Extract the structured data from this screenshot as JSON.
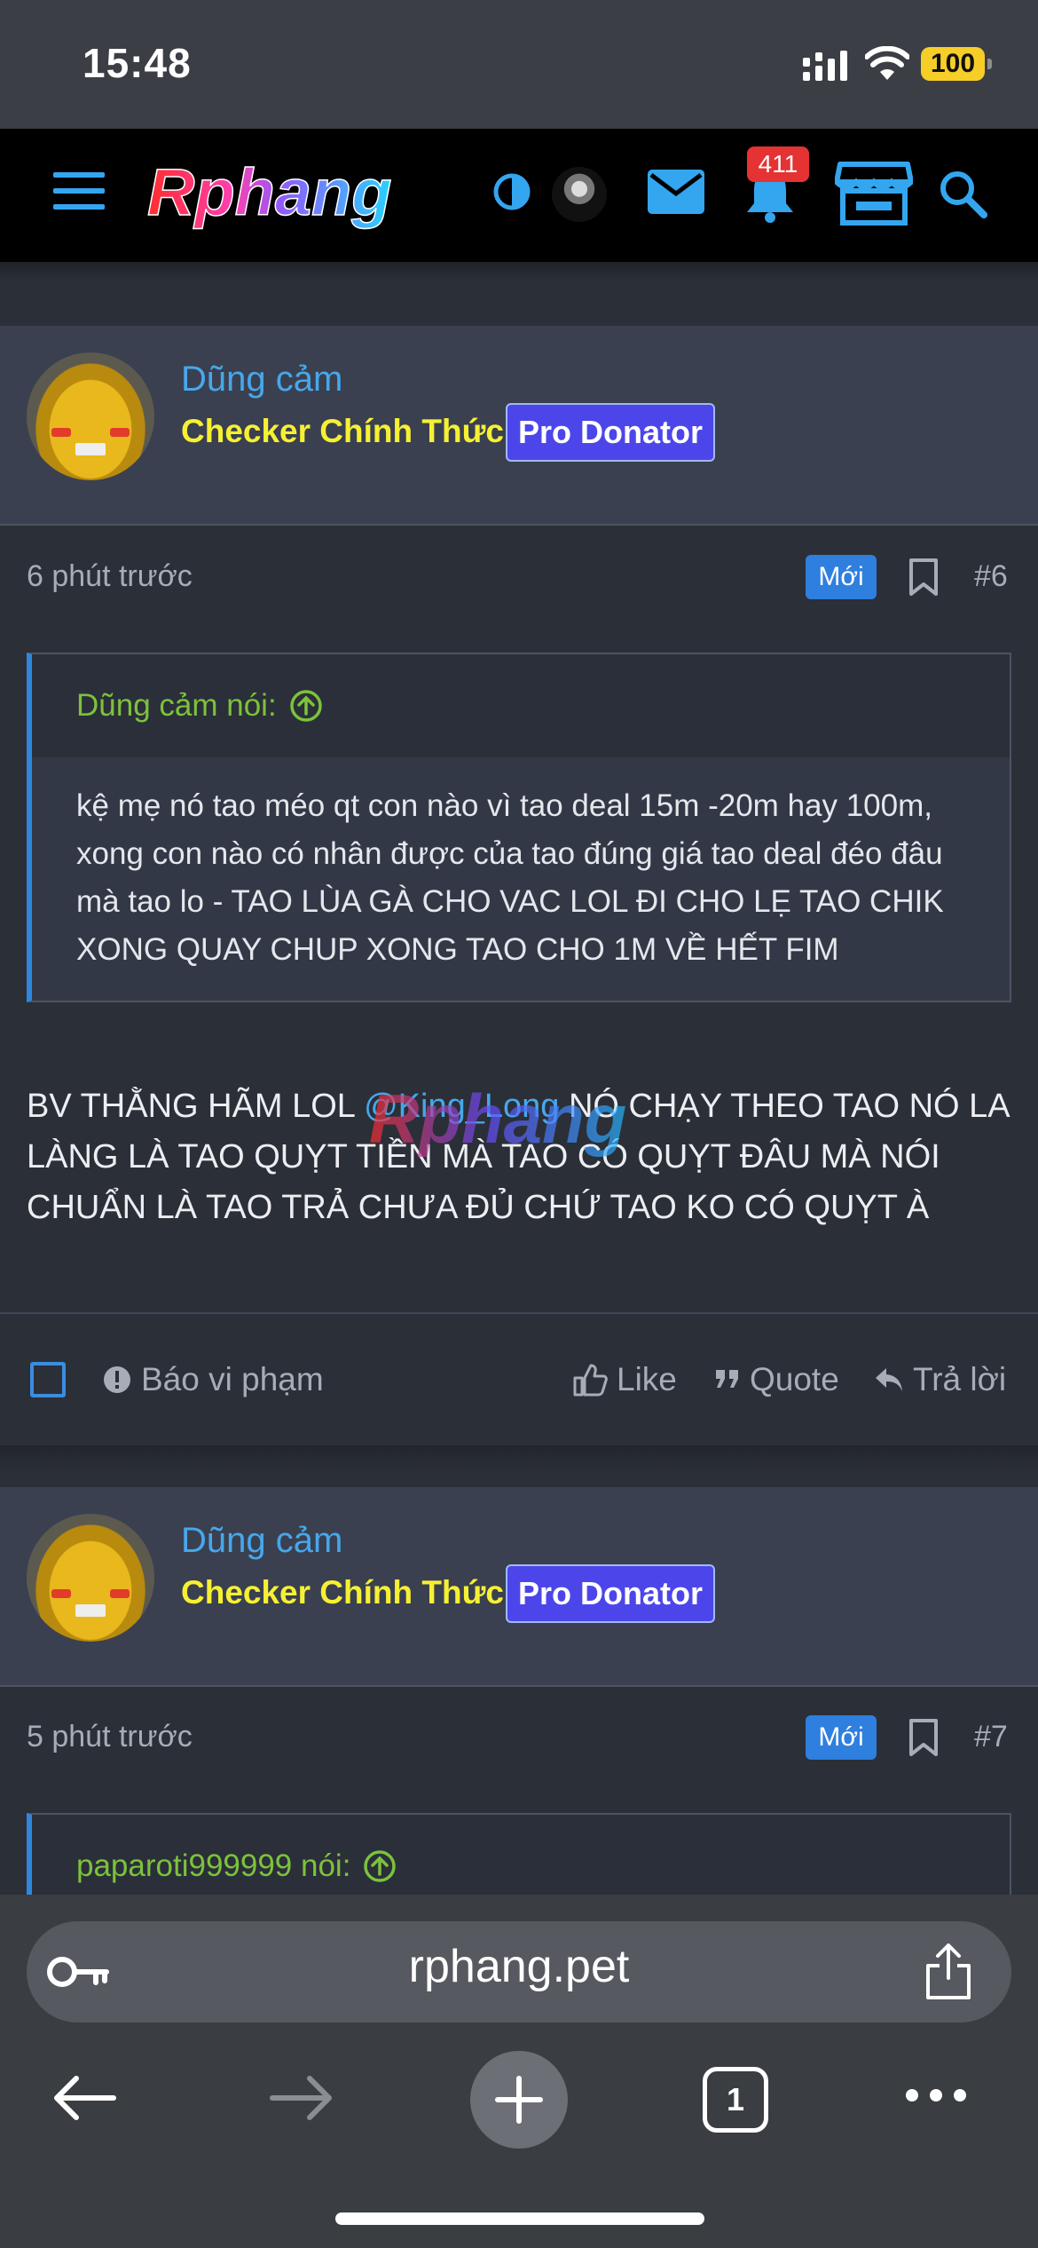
{
  "status": {
    "time": "15:48",
    "battery": "100"
  },
  "header": {
    "logo_text": "Rphang",
    "notification_count": "411"
  },
  "posts": [
    {
      "user": {
        "name": "Dũng cảm",
        "title": "Checker Chính Thức",
        "badge": "Pro Donator"
      },
      "time": "6 phút trước",
      "new_label": "Mới",
      "number": "#6",
      "quote": {
        "author": "Dũng cảm nói:",
        "text": "kệ mẹ nó tao méo qt con nào vì tao deal 15m -20m hay 100m, xong con nào có nhân được của tao đúng giá tao deal đéo đâu mà tao lo - TAO LÙA GÀ CHO VAC LOL ĐI CHO LẸ TAO CHIK XONG QUAY CHUP XONG TAO CHO 1M VỀ HẾT FIM"
      },
      "body_before": "BV THẰNG HÃM LOL ",
      "mention": "@King_Long",
      "body_after": " NÓ CHẠY THEO TAO NÓ LA LÀNG LÀ TAO QUỴT TIỀN MÀ TAO CÓ QUỴT ĐÂU MÀ NÓI CHUẨN LÀ TAO TRẢ CHƯA ĐỦ CHỨ TAO KO CÓ QUỴT À",
      "actions": {
        "report": "Báo vi phạm",
        "like": "Like",
        "quote": "Quote",
        "reply": "Trả lời"
      }
    },
    {
      "user": {
        "name": "Dũng cảm",
        "title": "Checker Chính Thức",
        "badge": "Pro Donator"
      },
      "time": "5 phút trước",
      "new_label": "Mới",
      "number": "#7",
      "quote": {
        "author": "paparoti999999 nói:"
      }
    }
  ],
  "browser": {
    "url": "rphang.pet",
    "tab_count": "1"
  },
  "colors": {
    "link": "#47a7eb",
    "title_yellow": "#f6f033",
    "quote_author": "#7cc23c",
    "badge_blue": "#4c46ea",
    "notification_red": "#e53232"
  }
}
